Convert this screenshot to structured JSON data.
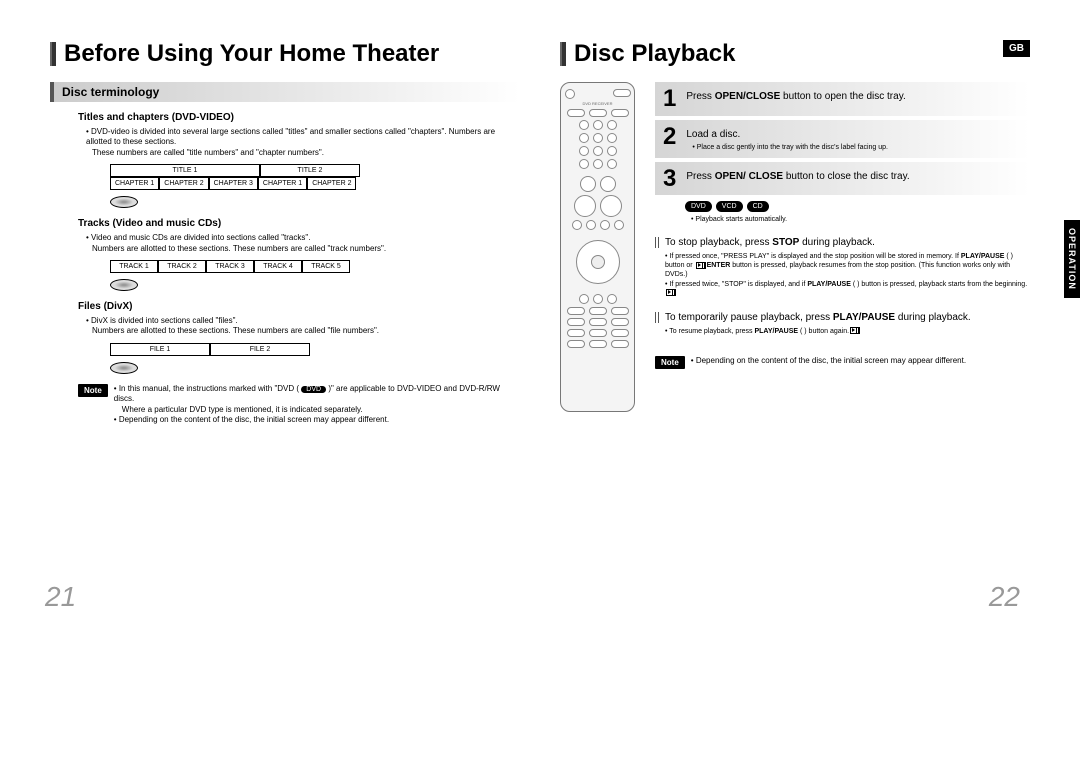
{
  "left": {
    "title": "Before Using Your Home Theater",
    "section": "Disc terminology",
    "titles_heading": "Titles and chapters (DVD-VIDEO)",
    "titles_bullet": "DVD-video is divided into several large sections called \"titles\" and smaller sections called \"chapters\". Numbers are allotted to these sections.",
    "titles_sub": "These numbers are called \"title numbers\" and \"chapter numbers\".",
    "diag1_title1": "TITLE 1",
    "diag1_title2": "TITLE 2",
    "diag1_ch1": "CHAPTER 1",
    "diag1_ch2": "CHAPTER 2",
    "diag1_ch3": "CHAPTER 3",
    "diag1_ch4": "CHAPTER 1",
    "diag1_ch5": "CHAPTER 2",
    "tracks_heading": "Tracks (Video and music CDs)",
    "tracks_bullet": "Video and music CDs are divided into sections called \"tracks\".",
    "tracks_sub": "Numbers are allotted to these sections. These numbers are called \"track numbers\".",
    "diag2_t1": "TRACK 1",
    "diag2_t2": "TRACK 2",
    "diag2_t3": "TRACK 3",
    "diag2_t4": "TRACK 4",
    "diag2_t5": "TRACK 5",
    "files_heading": "Files (DivX)",
    "files_bullet": "DivX is divided into sections called \"files\".",
    "files_sub": "Numbers are allotted to these sections. These numbers are called \"file numbers\".",
    "diag3_f1": "FILE 1",
    "diag3_f2": "FILE 2",
    "note_label": "Note",
    "note1_a": "In this manual, the instructions marked with \"DVD (",
    "note1_dvd": "DVD",
    "note1_b": ")\" are applicable to DVD-VIDEO and DVD-R/RW discs.",
    "note2": "Where a particular DVD type is mentioned, it is indicated separately.",
    "note3": "Depending on the content of the disc, the initial screen may appear different.",
    "page_num": "21"
  },
  "right": {
    "title": "Disc Playback",
    "gb": "GB",
    "side_tab": "OPERATION",
    "step1_a": "Press ",
    "step1_b": "OPEN/CLOSE",
    "step1_c": " button to open the disc tray.",
    "step2": "Load a disc.",
    "step2_sub": "Place a disc gently into the tray with the disc's label facing up.",
    "step3_a": "Press ",
    "step3_b": "OPEN/ CLOSE",
    "step3_c": " button to close the disc tray.",
    "pill_dvd": "DVD",
    "pill_vcd": "VCD",
    "pill_cd": "CD",
    "auto_play": "Playback starts automatically.",
    "stop_head_a": "To stop playback, press ",
    "stop_head_b": "STOP",
    "stop_head_c": " during playback.",
    "stop_b1_a": "If pressed once, \"PRESS PLAY\" is displayed and the stop position will be stored in memory. If ",
    "stop_b1_b": "PLAY/PAUSE",
    "stop_b1_c": " ( ) button or ",
    "stop_b1_d": "ENTER",
    "stop_b1_e": " button is pressed, playback resumes from the stop position. (This function works only with DVDs.)",
    "stop_b2_a": "If pressed twice, \"STOP\" is displayed, and if ",
    "stop_b2_b": "PLAY/PAUSE",
    "stop_b2_c": " ( ) button is pressed, playback starts from the beginning.",
    "pause_head_a": "To temporarily pause playback, press ",
    "pause_head_b": "PLAY/PAUSE",
    "pause_head_c": " during playback.",
    "pause_b1_a": "To resume playback, press ",
    "pause_b1_b": "PLAY/PAUSE",
    "pause_b1_c": " ( ) button again.",
    "note_label": "Note",
    "note_text": "Depending on the content of the disc, the initial screen may appear different.",
    "page_num": "22"
  }
}
